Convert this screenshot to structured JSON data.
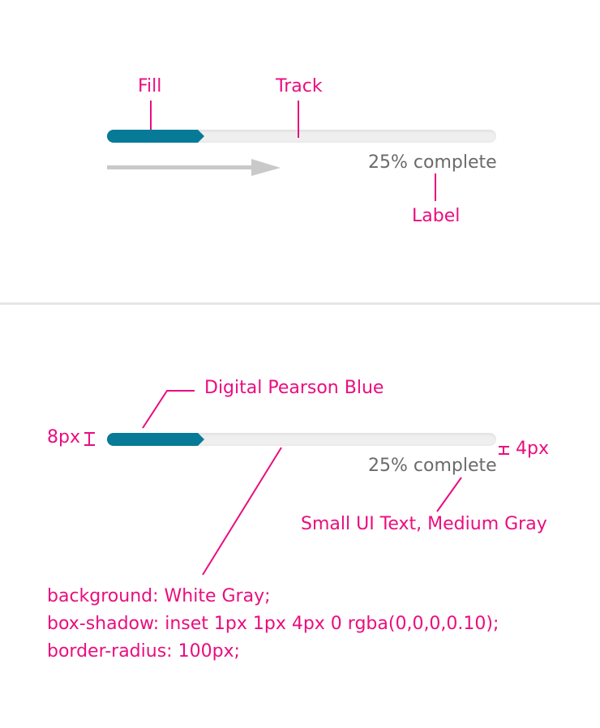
{
  "progress": {
    "value": 0.25
  },
  "top": {
    "callouts": {
      "fill": "Fill",
      "track": "Track",
      "label": "Label"
    },
    "progress_label": "25% complete"
  },
  "bottom": {
    "callouts": {
      "fill_color": "Digital Pearson Blue",
      "height_track": "8px",
      "height_shadow": "4px",
      "label_style": "Small UI Text, Medium Gray"
    },
    "progress_label": "25% complete",
    "css_notes": [
      "background: White Gray;",
      "box-shadow: inset 1px 1px 4px 0 rgba(0,0,0,0.10);",
      "border-radius: 100px;"
    ]
  },
  "colors": {
    "fill": "#077a98",
    "track": "#efefef",
    "annotation": "#ea0d7f",
    "label": "#6a6a6a",
    "arrow": "#c9c9c9"
  }
}
